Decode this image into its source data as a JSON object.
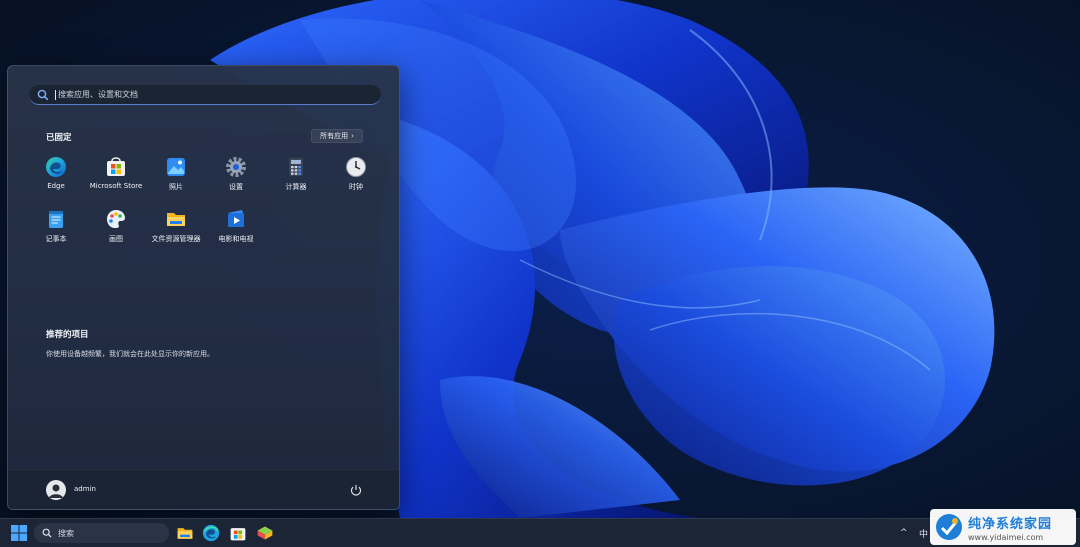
{
  "start_menu": {
    "search": {
      "placeholder": "搜索应用、设置和文档"
    },
    "pinned": {
      "title": "已固定",
      "all_apps_label": "所有应用",
      "apps": [
        {
          "label": "Edge",
          "icon": "edge-icon"
        },
        {
          "label": "Microsoft Store",
          "icon": "store-icon"
        },
        {
          "label": "照片",
          "icon": "photos-icon"
        },
        {
          "label": "设置",
          "icon": "settings-icon"
        },
        {
          "label": "计算器",
          "icon": "calculator-icon"
        },
        {
          "label": "时钟",
          "icon": "clock-icon"
        },
        {
          "label": "记事本",
          "icon": "notepad-icon"
        },
        {
          "label": "画图",
          "icon": "paint-icon"
        },
        {
          "label": "文件资源管理器",
          "icon": "folder-icon"
        },
        {
          "label": "电影和电视",
          "icon": "movies-icon"
        }
      ]
    },
    "recommended": {
      "title": "推荐的项目",
      "text": "你使用设备越频繁，我们就会在此处显示你的新应用。"
    },
    "user": {
      "name": "admin"
    }
  },
  "taskbar": {
    "search_label": "搜索",
    "pinned_icons": [
      "file-explorer-icon",
      "edge-icon",
      "store-icon",
      "app-icon"
    ],
    "ime_indicator": "中"
  },
  "watermark": {
    "title": "纯净系统家园",
    "url": "www.yidaimei.com"
  },
  "colors": {
    "accent": "#3b7de8",
    "menu_background": "#26324a",
    "taskbar_background": "#1c2535",
    "watermark_blue": "#1f7fd6"
  }
}
